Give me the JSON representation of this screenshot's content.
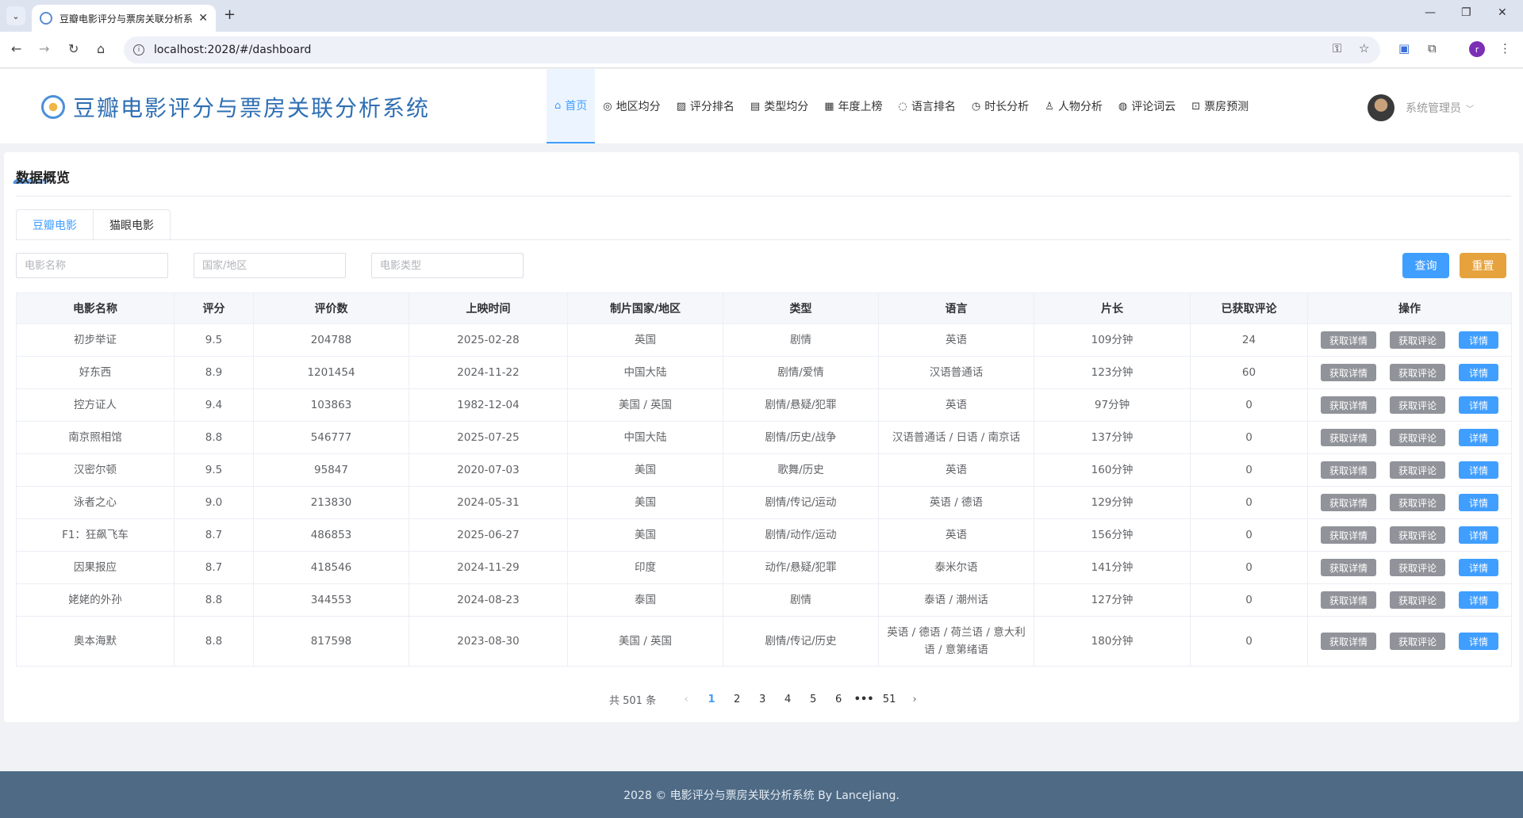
{
  "browser": {
    "tab_title": "豆瓣电影评分与票房关联分析系",
    "url": "localhost:2028/#/dashboard",
    "profile_initial": "r"
  },
  "app": {
    "title": "豆瓣电影评分与票房关联分析系统",
    "nav": [
      {
        "label": "首页",
        "icon": "home-icon"
      },
      {
        "label": "地区均分",
        "icon": "location-icon"
      },
      {
        "label": "评分排名",
        "icon": "trend-chart-icon"
      },
      {
        "label": "类型均分",
        "icon": "document-icon"
      },
      {
        "label": "年度上榜",
        "icon": "calendar-icon"
      },
      {
        "label": "语言排名",
        "icon": "chat-icon"
      },
      {
        "label": "时长分析",
        "icon": "timer-icon"
      },
      {
        "label": "人物分析",
        "icon": "user-icon"
      },
      {
        "label": "评论词云",
        "icon": "comment-icon"
      },
      {
        "label": "票房预测",
        "icon": "cart-icon"
      }
    ],
    "user_name": "系统管理员"
  },
  "section": {
    "title": "数据概览",
    "tabs": [
      "豆瓣电影",
      "猫眼电影"
    ]
  },
  "filters": {
    "name_placeholder": "电影名称",
    "region_placeholder": "国家/地区",
    "genre_placeholder": "电影类型",
    "search_label": "查询",
    "reset_label": "重置"
  },
  "table": {
    "headers": [
      "电影名称",
      "评分",
      "评价数",
      "上映时间",
      "制片国家/地区",
      "类型",
      "语言",
      "片长",
      "已获取评论",
      "操作"
    ],
    "op_labels": {
      "details": "获取详情",
      "comments": "获取评论",
      "view": "详情"
    },
    "rows": [
      [
        "初步举证",
        "9.5",
        "204788",
        "2025-02-28",
        "英国",
        "剧情",
        "英语",
        "109分钟",
        "24"
      ],
      [
        "好东西",
        "8.9",
        "1201454",
        "2024-11-22",
        "中国大陆",
        "剧情/爱情",
        "汉语普通话",
        "123分钟",
        "60"
      ],
      [
        "控方证人",
        "9.4",
        "103863",
        "1982-12-04",
        "美国 / 英国",
        "剧情/悬疑/犯罪",
        "英语",
        "97分钟",
        "0"
      ],
      [
        "南京照相馆",
        "8.8",
        "546777",
        "2025-07-25",
        "中国大陆",
        "剧情/历史/战争",
        "汉语普通话 / 日语 / 南京话",
        "137分钟",
        "0"
      ],
      [
        "汉密尔顿",
        "9.5",
        "95847",
        "2020-07-03",
        "美国",
        "歌舞/历史",
        "英语",
        "160分钟",
        "0"
      ],
      [
        "泳者之心",
        "9.0",
        "213830",
        "2024-05-31",
        "美国",
        "剧情/传记/运动",
        "英语 / 德语",
        "129分钟",
        "0"
      ],
      [
        "F1：狂飙飞车",
        "8.7",
        "486853",
        "2025-06-27",
        "美国",
        "剧情/动作/运动",
        "英语",
        "156分钟",
        "0"
      ],
      [
        "因果报应",
        "8.7",
        "418546",
        "2024-11-29",
        "印度",
        "动作/悬疑/犯罪",
        "泰米尔语",
        "141分钟",
        "0"
      ],
      [
        "姥姥的外孙",
        "8.8",
        "344553",
        "2024-08-23",
        "泰国",
        "剧情",
        "泰语 / 潮州话",
        "127分钟",
        "0"
      ],
      [
        "奥本海默",
        "8.8",
        "817598",
        "2023-08-30",
        "美国 / 英国",
        "剧情/传记/历史",
        "英语 / 德语 / 荷兰语 / 意大利语 / 意第绪语",
        "180分钟",
        "0"
      ]
    ]
  },
  "pagination": {
    "total": "共 501 条",
    "pages": [
      "1",
      "2",
      "3",
      "4",
      "5",
      "6"
    ],
    "more": "•••",
    "last": "51",
    "current": "1"
  },
  "footer": "2028 © 电影评分与票房关联分析系统 By LanceJiang."
}
